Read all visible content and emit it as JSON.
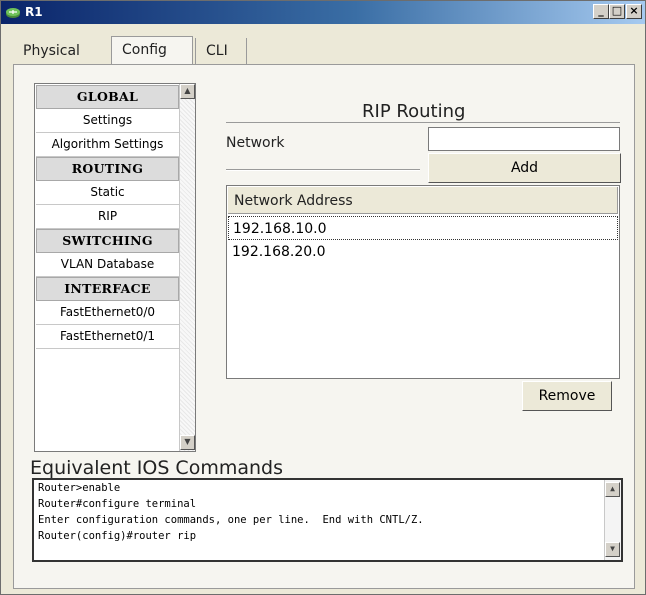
{
  "window": {
    "title": "R1",
    "controls": {
      "minimize": "_",
      "maximize": "□",
      "close": "×"
    }
  },
  "tabs": [
    {
      "label": "Physical"
    },
    {
      "label": "Config"
    },
    {
      "label": "CLI"
    }
  ],
  "active_tab": "Config",
  "sidebar": {
    "items": [
      {
        "label": "GLOBAL",
        "type": "header"
      },
      {
        "label": "Settings",
        "type": "item"
      },
      {
        "label": "Algorithm Settings",
        "type": "item"
      },
      {
        "label": "ROUTING",
        "type": "header"
      },
      {
        "label": "Static",
        "type": "item"
      },
      {
        "label": "RIP",
        "type": "item"
      },
      {
        "label": "SWITCHING",
        "type": "header"
      },
      {
        "label": "VLAN Database",
        "type": "item"
      },
      {
        "label": "INTERFACE",
        "type": "header"
      },
      {
        "label": "FastEthernet0/0",
        "type": "item"
      },
      {
        "label": "FastEthernet0/1",
        "type": "item"
      }
    ]
  },
  "rip": {
    "title": "RIP Routing",
    "network_label": "Network",
    "network_value": "",
    "add_label": "Add",
    "table_header": "Network Address",
    "rows": [
      "192.168.10.0",
      "192.168.20.0"
    ],
    "remove_label": "Remove"
  },
  "ios": {
    "title": "Equivalent IOS Commands",
    "lines": [
      "Router>enable",
      "Router#configure terminal",
      "Enter configuration commands, one per line.  End with CNTL/Z.",
      "Router(config)#router rip"
    ]
  }
}
